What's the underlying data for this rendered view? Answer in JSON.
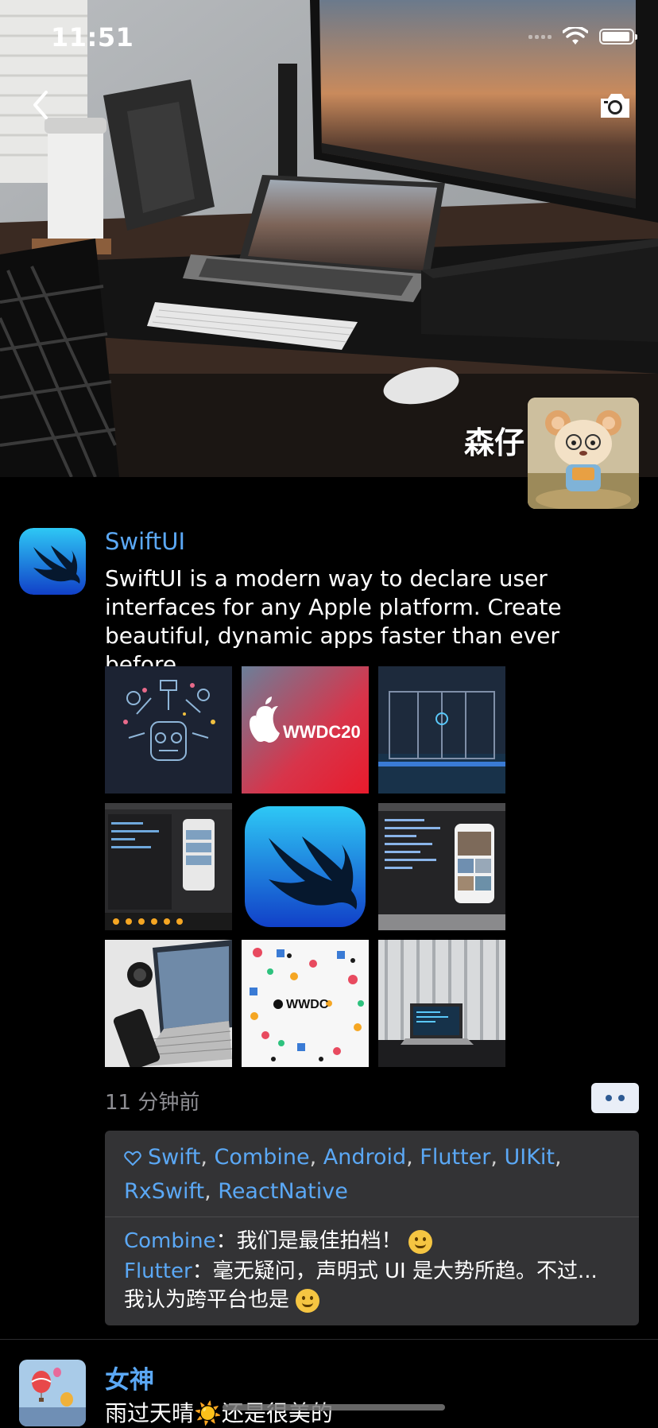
{
  "status_bar": {
    "time": "11:51"
  },
  "profile": {
    "name": "森仔"
  },
  "post": {
    "author": "SwiftUI",
    "text": "SwiftUI is a modern way to declare user interfaces for any Apple platform. Create beautiful, dynamic apps faster than ever before.",
    "images": [
      {
        "icon": "wwdc-doodle-head"
      },
      {
        "icon": "wwdc-2019-banner",
        "label": "WWDC20"
      },
      {
        "icon": "apple-store-glass"
      },
      {
        "icon": "xcode-screenshot"
      },
      {
        "icon": "swift-logo"
      },
      {
        "icon": "xcode-preview-screenshot"
      },
      {
        "icon": "laptop-phone-desk"
      },
      {
        "icon": "wwdc-stickers",
        "label": "WWDC"
      },
      {
        "icon": "laptop-window"
      }
    ],
    "time": "11 分钟前",
    "likes": [
      "Swift",
      "Combine",
      "Android",
      "Flutter",
      "UIKit",
      "RxSwift",
      "ReactNative"
    ],
    "comments": [
      {
        "author": "Combine",
        "text": "我们是最佳拍档！"
      },
      {
        "author": "Flutter",
        "text": "毫无疑问，声明式 UI 是大势所趋。不过... 我认为跨平台也是"
      }
    ]
  },
  "next_post": {
    "author": "女神",
    "text": "雨过天晴☀️还是很美的"
  },
  "colors": {
    "link": "#5ba8f5",
    "panel": "#333335",
    "muted": "#8e8e93"
  }
}
